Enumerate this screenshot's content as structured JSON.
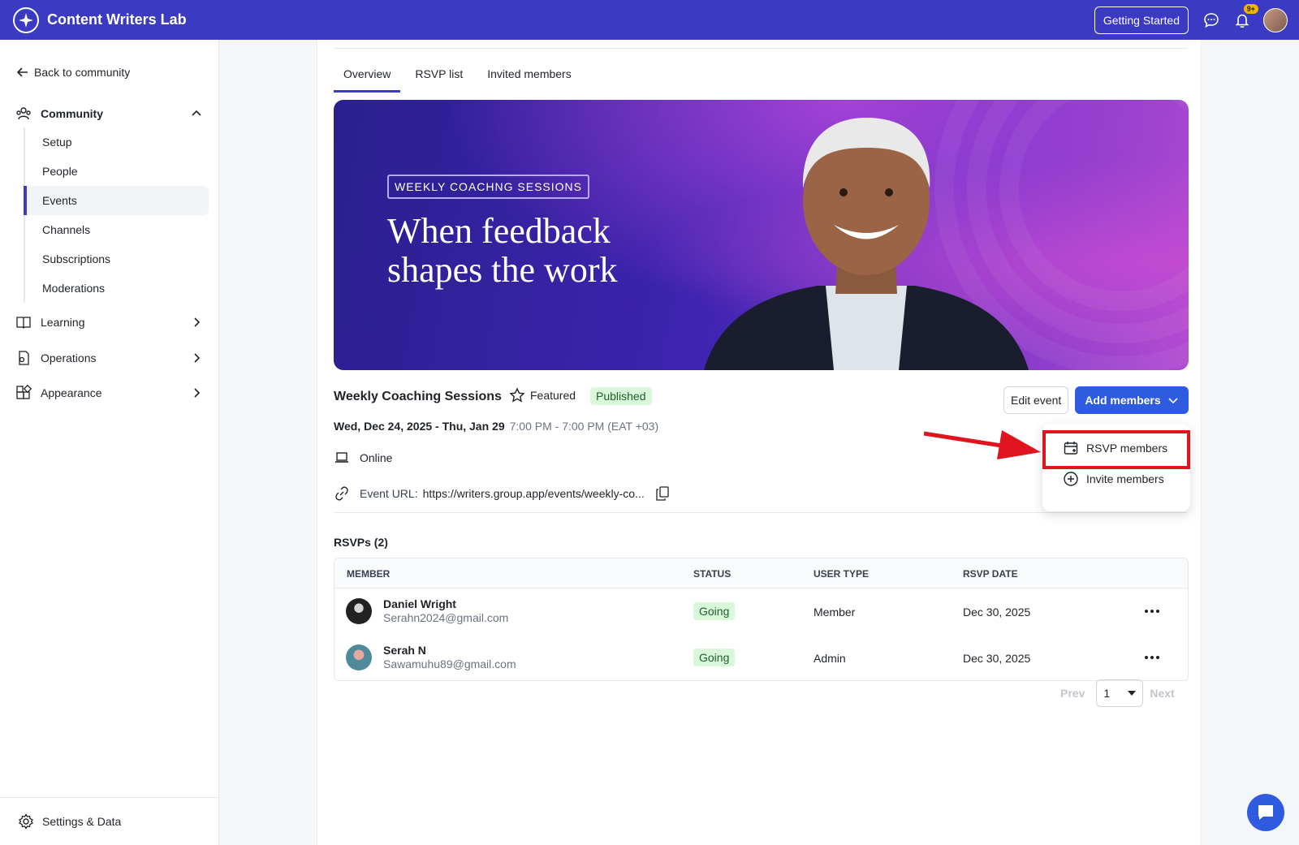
{
  "topbar": {
    "brand": "Content Writers Lab",
    "getting_started": "Getting Started",
    "notification_badge": "9+"
  },
  "sidebar": {
    "back": "Back to community",
    "community": "Community",
    "sub_items": [
      {
        "label": "Setup"
      },
      {
        "label": "People"
      },
      {
        "label": "Events"
      },
      {
        "label": "Channels"
      },
      {
        "label": "Subscriptions"
      },
      {
        "label": "Moderations"
      }
    ],
    "learning": "Learning",
    "operations": "Operations",
    "appearance": "Appearance",
    "settings": "Settings & Data"
  },
  "tabs": [
    "Overview",
    "RSVP list",
    "Invited members"
  ],
  "banner": {
    "tag": "WEEKLY COACHNG SESSIONS",
    "title": "When feedback shapes the work"
  },
  "event": {
    "title": "Weekly Coaching Sessions",
    "featured": "Featured",
    "status": "Published",
    "edit": "Edit event",
    "add_members": "Add members",
    "date_range": "Wed, Dec 24, 2025 - Thu, Jan 29",
    "time": "7:00 PM - 7:00 PM (EAT +03)",
    "location": "Online",
    "url_label": "Event URL:",
    "url": "https://writers.group.app/events/weekly-co..."
  },
  "dropdown": {
    "rsvp": "RSVP members",
    "invite": "Invite members"
  },
  "rsvps": {
    "title": "RSVPs (2)",
    "columns": [
      "MEMBER",
      "STATUS",
      "USER TYPE",
      "RSVP DATE"
    ],
    "rows": [
      {
        "name": "Daniel Wright",
        "email": "Serahn2024@gmail.com",
        "status": "Going",
        "type": "Member",
        "date": "Dec 30, 2025"
      },
      {
        "name": "Serah N",
        "email": "Sawamuhu89@gmail.com",
        "status": "Going",
        "type": "Admin",
        "date": "Dec 30, 2025"
      }
    ]
  },
  "pager": {
    "prev": "Prev",
    "page": "1",
    "next": "Next"
  },
  "colors": {
    "brand": "#3a3ac2",
    "primary_button": "#2e5be0",
    "highlight": "#e0141e",
    "success_bg": "#d9f7d9"
  }
}
